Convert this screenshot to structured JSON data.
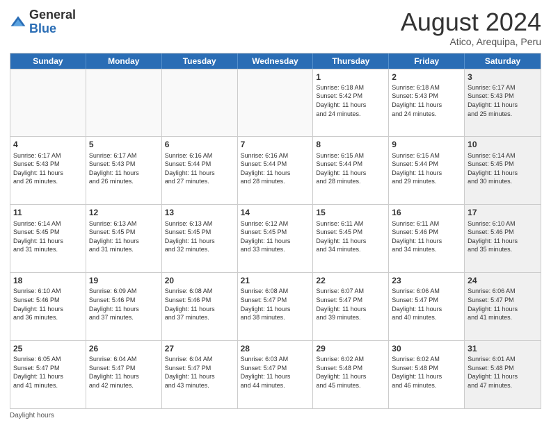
{
  "header": {
    "logo_general": "General",
    "logo_blue": "Blue",
    "main_title": "August 2024",
    "subtitle": "Atico, Arequipa, Peru"
  },
  "calendar": {
    "days_of_week": [
      "Sunday",
      "Monday",
      "Tuesday",
      "Wednesday",
      "Thursday",
      "Friday",
      "Saturday"
    ],
    "weeks": [
      [
        {
          "day": "",
          "info": "",
          "empty": true
        },
        {
          "day": "",
          "info": "",
          "empty": true
        },
        {
          "day": "",
          "info": "",
          "empty": true
        },
        {
          "day": "",
          "info": "",
          "empty": true
        },
        {
          "day": "1",
          "info": "Sunrise: 6:18 AM\nSunset: 5:42 PM\nDaylight: 11 hours\nand 24 minutes.",
          "empty": false
        },
        {
          "day": "2",
          "info": "Sunrise: 6:18 AM\nSunset: 5:43 PM\nDaylight: 11 hours\nand 24 minutes.",
          "empty": false
        },
        {
          "day": "3",
          "info": "Sunrise: 6:17 AM\nSunset: 5:43 PM\nDaylight: 11 hours\nand 25 minutes.",
          "empty": false,
          "shaded": true
        }
      ],
      [
        {
          "day": "4",
          "info": "Sunrise: 6:17 AM\nSunset: 5:43 PM\nDaylight: 11 hours\nand 26 minutes.",
          "empty": false
        },
        {
          "day": "5",
          "info": "Sunrise: 6:17 AM\nSunset: 5:43 PM\nDaylight: 11 hours\nand 26 minutes.",
          "empty": false
        },
        {
          "day": "6",
          "info": "Sunrise: 6:16 AM\nSunset: 5:44 PM\nDaylight: 11 hours\nand 27 minutes.",
          "empty": false
        },
        {
          "day": "7",
          "info": "Sunrise: 6:16 AM\nSunset: 5:44 PM\nDaylight: 11 hours\nand 28 minutes.",
          "empty": false
        },
        {
          "day": "8",
          "info": "Sunrise: 6:15 AM\nSunset: 5:44 PM\nDaylight: 11 hours\nand 28 minutes.",
          "empty": false
        },
        {
          "day": "9",
          "info": "Sunrise: 6:15 AM\nSunset: 5:44 PM\nDaylight: 11 hours\nand 29 minutes.",
          "empty": false
        },
        {
          "day": "10",
          "info": "Sunrise: 6:14 AM\nSunset: 5:45 PM\nDaylight: 11 hours\nand 30 minutes.",
          "empty": false,
          "shaded": true
        }
      ],
      [
        {
          "day": "11",
          "info": "Sunrise: 6:14 AM\nSunset: 5:45 PM\nDaylight: 11 hours\nand 31 minutes.",
          "empty": false
        },
        {
          "day": "12",
          "info": "Sunrise: 6:13 AM\nSunset: 5:45 PM\nDaylight: 11 hours\nand 31 minutes.",
          "empty": false
        },
        {
          "day": "13",
          "info": "Sunrise: 6:13 AM\nSunset: 5:45 PM\nDaylight: 11 hours\nand 32 minutes.",
          "empty": false
        },
        {
          "day": "14",
          "info": "Sunrise: 6:12 AM\nSunset: 5:45 PM\nDaylight: 11 hours\nand 33 minutes.",
          "empty": false
        },
        {
          "day": "15",
          "info": "Sunrise: 6:11 AM\nSunset: 5:45 PM\nDaylight: 11 hours\nand 34 minutes.",
          "empty": false
        },
        {
          "day": "16",
          "info": "Sunrise: 6:11 AM\nSunset: 5:46 PM\nDaylight: 11 hours\nand 34 minutes.",
          "empty": false
        },
        {
          "day": "17",
          "info": "Sunrise: 6:10 AM\nSunset: 5:46 PM\nDaylight: 11 hours\nand 35 minutes.",
          "empty": false,
          "shaded": true
        }
      ],
      [
        {
          "day": "18",
          "info": "Sunrise: 6:10 AM\nSunset: 5:46 PM\nDaylight: 11 hours\nand 36 minutes.",
          "empty": false
        },
        {
          "day": "19",
          "info": "Sunrise: 6:09 AM\nSunset: 5:46 PM\nDaylight: 11 hours\nand 37 minutes.",
          "empty": false
        },
        {
          "day": "20",
          "info": "Sunrise: 6:08 AM\nSunset: 5:46 PM\nDaylight: 11 hours\nand 37 minutes.",
          "empty": false
        },
        {
          "day": "21",
          "info": "Sunrise: 6:08 AM\nSunset: 5:47 PM\nDaylight: 11 hours\nand 38 minutes.",
          "empty": false
        },
        {
          "day": "22",
          "info": "Sunrise: 6:07 AM\nSunset: 5:47 PM\nDaylight: 11 hours\nand 39 minutes.",
          "empty": false
        },
        {
          "day": "23",
          "info": "Sunrise: 6:06 AM\nSunset: 5:47 PM\nDaylight: 11 hours\nand 40 minutes.",
          "empty": false
        },
        {
          "day": "24",
          "info": "Sunrise: 6:06 AM\nSunset: 5:47 PM\nDaylight: 11 hours\nand 41 minutes.",
          "empty": false,
          "shaded": true
        }
      ],
      [
        {
          "day": "25",
          "info": "Sunrise: 6:05 AM\nSunset: 5:47 PM\nDaylight: 11 hours\nand 41 minutes.",
          "empty": false
        },
        {
          "day": "26",
          "info": "Sunrise: 6:04 AM\nSunset: 5:47 PM\nDaylight: 11 hours\nand 42 minutes.",
          "empty": false
        },
        {
          "day": "27",
          "info": "Sunrise: 6:04 AM\nSunset: 5:47 PM\nDaylight: 11 hours\nand 43 minutes.",
          "empty": false
        },
        {
          "day": "28",
          "info": "Sunrise: 6:03 AM\nSunset: 5:47 PM\nDaylight: 11 hours\nand 44 minutes.",
          "empty": false
        },
        {
          "day": "29",
          "info": "Sunrise: 6:02 AM\nSunset: 5:48 PM\nDaylight: 11 hours\nand 45 minutes.",
          "empty": false
        },
        {
          "day": "30",
          "info": "Sunrise: 6:02 AM\nSunset: 5:48 PM\nDaylight: 11 hours\nand 46 minutes.",
          "empty": false
        },
        {
          "day": "31",
          "info": "Sunrise: 6:01 AM\nSunset: 5:48 PM\nDaylight: 11 hours\nand 47 minutes.",
          "empty": false,
          "shaded": true
        }
      ]
    ]
  },
  "footer": {
    "label": "Daylight hours"
  }
}
